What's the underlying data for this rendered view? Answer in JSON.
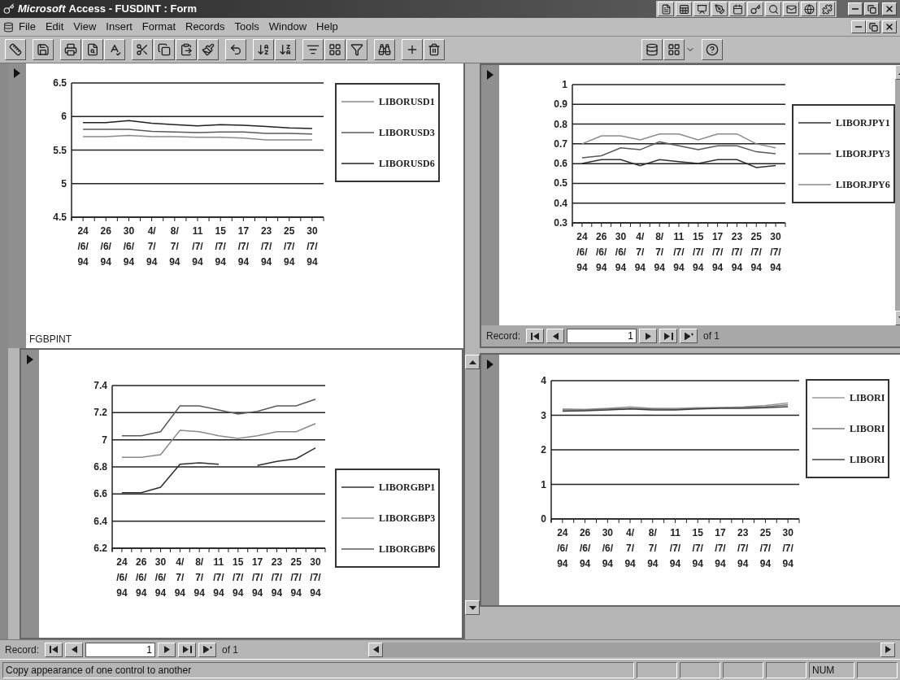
{
  "window": {
    "brand": "Microsoft",
    "title": "Access - FUSDINT : Form"
  },
  "menu": [
    "File",
    "Edit",
    "View",
    "Insert",
    "Format",
    "Records",
    "Tools",
    "Window",
    "Help"
  ],
  "forms": [
    {
      "chart_data": {
        "type": "line",
        "grid": true,
        "categories": [
          "24\n/6/\n94",
          "26\n/6/\n94",
          "30\n/6/\n94",
          "4/\n7/\n94",
          "8/\n7/\n94",
          "11\n/7/\n94",
          "15\n/7/\n94",
          "17\n/7/\n94",
          "23\n/7/\n94",
          "25\n/7/\n94",
          "30\n/7/\n94"
        ],
        "ylim": [
          4.5,
          6.5
        ],
        "yticks": [
          {
            "value": 4.5,
            "label": "4.5"
          },
          {
            "value": 5,
            "label": "5"
          },
          {
            "value": 5.5,
            "label": "5.5"
          },
          {
            "value": 6,
            "label": "6"
          },
          {
            "value": 6.5,
            "label": "6.5"
          }
        ],
        "series": [
          {
            "name": "LIBORUSD1",
            "color": "#8a8a8a",
            "values": [
              5.7,
              5.7,
              5.72,
              5.7,
              5.7,
              5.69,
              5.69,
              5.68,
              5.65,
              5.65,
              5.65
            ]
          },
          {
            "name": "LIBORUSD3",
            "color": "#5a5a5a",
            "values": [
              5.81,
              5.81,
              5.81,
              5.78,
              5.77,
              5.76,
              5.77,
              5.77,
              5.75,
              5.75,
              5.74
            ]
          },
          {
            "name": "LIBORUSD6",
            "color": "#202020",
            "values": [
              5.91,
              5.91,
              5.94,
              5.9,
              5.88,
              5.86,
              5.88,
              5.87,
              5.85,
              5.83,
              5.82
            ]
          }
        ]
      }
    },
    {
      "chart_data": {
        "type": "line",
        "categories": [
          "24\n/6/\n94",
          "26\n/6/\n94",
          "30\n/6/\n94",
          "4/\n7/\n94",
          "8/\n7/\n94",
          "11\n/7/\n94",
          "15\n/7/\n94",
          "17\n/7/\n94",
          "23\n/7/\n94",
          "25\n/7/\n94",
          "30\n/7/\n94"
        ],
        "ylim": [
          0.3,
          1
        ],
        "grid": true,
        "yticks": [
          {
            "value": 0.3,
            "label": "0.3"
          },
          {
            "value": 0.4,
            "label": "0.4"
          },
          {
            "value": 0.5,
            "label": "0.5"
          },
          {
            "value": 0.6,
            "label": "0.6"
          },
          {
            "value": 0.7,
            "label": "0.7"
          },
          {
            "value": 0.8,
            "label": "0.8"
          },
          {
            "value": 0.9,
            "label": "0.9"
          },
          {
            "value": 1,
            "label": "1"
          }
        ],
        "series": [
          {
            "name": "LIBORJPY1",
            "color": "#303030",
            "values": [
              0.6,
              0.62,
              0.62,
              0.59,
              0.62,
              0.61,
              0.6,
              0.62,
              0.62,
              0.58,
              0.59
            ]
          },
          {
            "name": "LIBORJPY3",
            "color": "#5a5a5a",
            "values": [
              0.63,
              0.64,
              0.68,
              0.67,
              0.71,
              0.69,
              0.67,
              0.69,
              0.69,
              0.66,
              0.65
            ]
          },
          {
            "name": "LIBORJPY6",
            "color": "#8a8a8a",
            "values": [
              0.7,
              0.74,
              0.74,
              0.72,
              0.75,
              0.75,
              0.72,
              0.75,
              0.75,
              0.7,
              0.68
            ]
          }
        ]
      }
    },
    {
      "chart_data": {
        "type": "line",
        "categories": [
          "24\n/6/\n94",
          "26\n/6/\n94",
          "30\n/6/\n94",
          "4/\n7/\n94",
          "8/\n7/\n94",
          "11\n/7/\n94",
          "15\n/7/\n94",
          "17\n/7/\n94",
          "23\n/7/\n94",
          "25\n/7/\n94",
          "30\n/7/\n94"
        ],
        "ylim": [
          6.2,
          7.4
        ],
        "grid": true,
        "yticks": [
          {
            "value": 6.2,
            "label": "6.2"
          },
          {
            "value": 6.4,
            "label": "6.4"
          },
          {
            "value": 6.6,
            "label": "6.6"
          },
          {
            "value": 6.8,
            "label": "6.8"
          },
          {
            "value": 7,
            "label": "7"
          },
          {
            "value": 7.2,
            "label": "7.2"
          },
          {
            "value": 7.4,
            "label": "7.4"
          }
        ],
        "series": [
          {
            "name": "LIBORGBP1",
            "color": "#303030",
            "values": [
              6.61,
              6.61,
              6.65,
              6.82,
              6.83,
              6.82,
              null,
              6.81,
              6.84,
              6.86,
              6.94
            ]
          },
          {
            "name": "LIBORGBP3",
            "color": "#8a8a8a",
            "values": [
              6.87,
              6.87,
              6.89,
              7.07,
              7.06,
              7.03,
              7.01,
              7.03,
              7.06,
              7.06,
              7.12
            ]
          },
          {
            "name": "LIBORGBP6",
            "color": "#5a5a5a",
            "values": [
              7.03,
              7.03,
              7.06,
              7.25,
              7.25,
              7.22,
              7.19,
              7.21,
              7.25,
              7.25,
              7.3
            ]
          }
        ]
      }
    },
    {
      "chart_data": {
        "type": "line",
        "categories": [
          "24\n/6/\n94",
          "26\n/6/\n94",
          "30\n/6/\n94",
          "4/\n7/\n94",
          "8/\n7/\n94",
          "11\n/7/\n94",
          "15\n/7/\n94",
          "17\n/7/\n94",
          "23\n/7/\n94",
          "25\n/7/\n94",
          "30\n/7/\n94"
        ],
        "ylim": [
          0,
          4
        ],
        "grid": true,
        "yticks": [
          {
            "value": 0,
            "label": "0"
          },
          {
            "value": 1,
            "label": "1"
          },
          {
            "value": 2,
            "label": "2"
          },
          {
            "value": 3,
            "label": "3"
          },
          {
            "value": 4,
            "label": "4"
          }
        ],
        "series": [
          {
            "name": "LIBORI",
            "color": "#9a9a9a",
            "values": [
              3.18,
              3.17,
              3.2,
              3.24,
              3.2,
              3.2,
              3.22,
              3.22,
              3.24,
              3.28,
              3.35
            ]
          },
          {
            "name": "LIBORI",
            "color": "#7a7a7a",
            "values": [
              3.15,
              3.15,
              3.18,
              3.2,
              3.18,
              3.17,
              3.2,
              3.22,
              3.23,
              3.25,
              3.3
            ]
          },
          {
            "name": "LIBORI",
            "color": "#404040",
            "values": [
              3.12,
              3.13,
              3.15,
              3.18,
              3.15,
              3.15,
              3.18,
              3.2,
              3.2,
              3.22,
              3.25
            ]
          }
        ]
      }
    }
  ],
  "form_label": "FGBPINT",
  "subform_nav": {
    "label": "Record:",
    "value": "1",
    "of": "of 1"
  },
  "record_nav": {
    "label": "Record:",
    "value": "1",
    "of": "of 1"
  },
  "status_bar": {
    "message": "Copy appearance of one control to another",
    "indicator": "NUM"
  }
}
